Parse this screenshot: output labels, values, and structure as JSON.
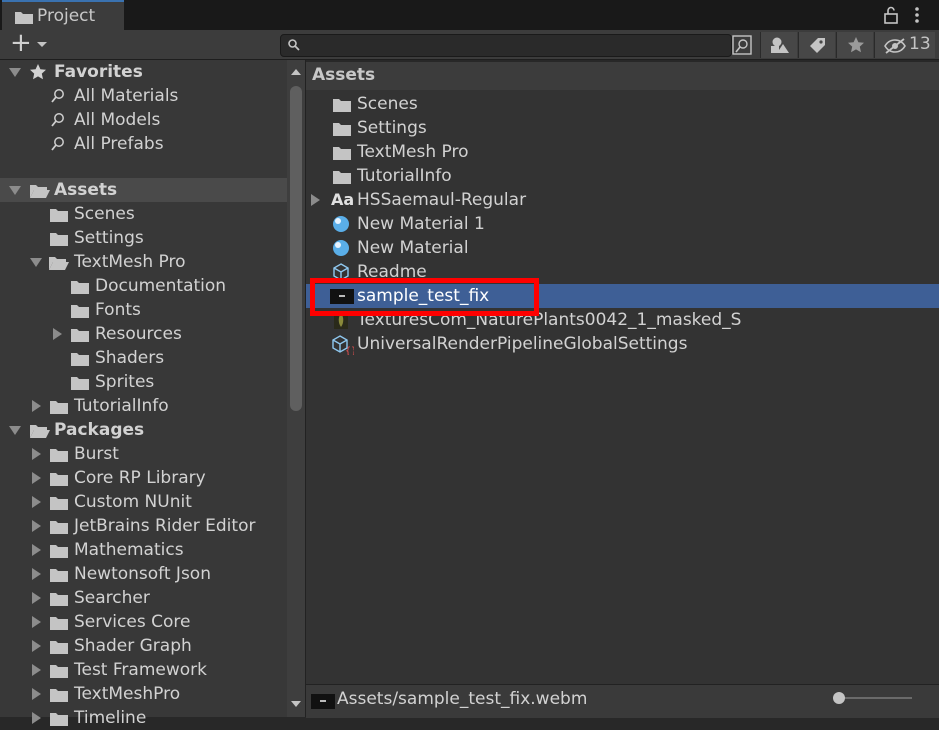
{
  "window": {
    "tab_title": "Project",
    "hidden_count": "13"
  },
  "toolbar": {
    "add_label": "+",
    "search_placeholder": ""
  },
  "tree": {
    "favorites": {
      "label": "Favorites",
      "items": [
        "All Materials",
        "All Models",
        "All Prefabs"
      ]
    },
    "assets": {
      "label": "Assets",
      "children": [
        {
          "label": "Scenes"
        },
        {
          "label": "Settings"
        },
        {
          "label": "TextMesh Pro",
          "children": [
            "Documentation",
            "Fonts",
            "Resources",
            "Shaders",
            "Sprites"
          ]
        },
        {
          "label": "TutorialInfo"
        }
      ]
    },
    "packages": {
      "label": "Packages",
      "items": [
        "Burst",
        "Core RP Library",
        "Custom NUnit",
        "JetBrains Rider Editor",
        "Mathematics",
        "Newtonsoft Json",
        "Searcher",
        "Services Core",
        "Shader Graph",
        "Test Framework",
        "TextMeshPro",
        "Timeline"
      ]
    }
  },
  "content": {
    "header": "Assets",
    "items": [
      {
        "label": "Scenes",
        "icon": "folder-icon"
      },
      {
        "label": "Settings",
        "icon": "folder-icon"
      },
      {
        "label": "TextMesh Pro",
        "icon": "folder-icon"
      },
      {
        "label": "TutorialInfo",
        "icon": "folder-icon"
      },
      {
        "label": "HSSaemaul-Regular",
        "icon": "font-icon",
        "font_glyph": "Aa"
      },
      {
        "label": "New Material 1",
        "icon": "material-icon"
      },
      {
        "label": "New Material",
        "icon": "material-icon"
      },
      {
        "label": "Readme",
        "icon": "scriptable-object-icon"
      },
      {
        "label": "sample_test_fix",
        "icon": "video-icon",
        "selected": true
      },
      {
        "label": "TexturesCom_NaturePlants0042_1_masked_S",
        "icon": "texture-icon"
      },
      {
        "label": "UniversalRenderPipelineGlobalSettings",
        "icon": "settings-asset-icon"
      }
    ]
  },
  "footer": {
    "path": "Assets/sample_test_fix.webm"
  },
  "colors": {
    "selection": "#3e5f96",
    "highlight_box": "#ff0000",
    "material_blue": "#5aaee8"
  }
}
